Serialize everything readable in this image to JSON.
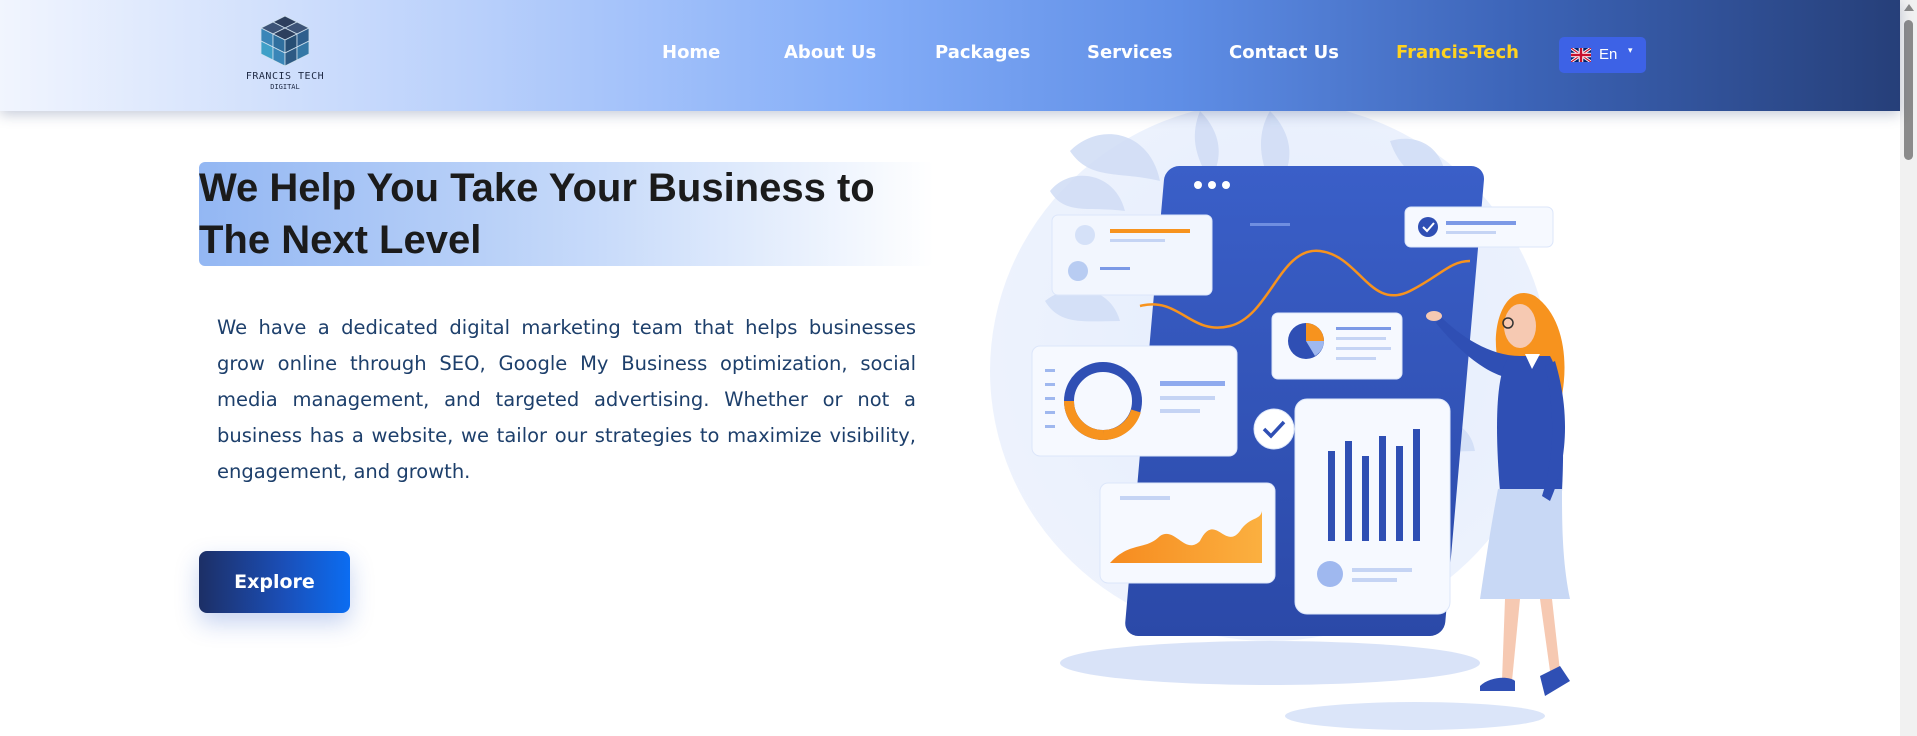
{
  "header": {
    "logo": {
      "name": "FRANCIS TECH",
      "sub": "DIGITAL"
    },
    "nav": [
      {
        "label": "Home"
      },
      {
        "label": "About Us"
      },
      {
        "label": "Packages"
      },
      {
        "label": "Services"
      },
      {
        "label": "Contact Us"
      },
      {
        "label": "Francis-Tech"
      }
    ],
    "language": {
      "label": "En",
      "flag": "uk-flag-icon"
    }
  },
  "hero": {
    "title_line1": "We Help You Take Your Business to",
    "title_line2": "The Next Level",
    "description": "We have a dedicated digital marketing team that helps businesses grow online through SEO, Google My Business optimization, social media management, and targeted advertising. Whether or not a business has a website, we tailor our strategies to maximize visibility, engagement, and growth.",
    "button_label": "Explore"
  },
  "colors": {
    "brand_accent": "#ffd21f",
    "nav_text": "#ffffff",
    "lang_button": "#3d62e6",
    "illustration_orange": "#f7931e",
    "illustration_blue": "#2f4fb4"
  },
  "icons": [
    "cube-logo-icon",
    "uk-flag-icon",
    "chevron-down-icon",
    "check-circle-icon",
    "donut-chart-icon",
    "pie-chart-icon",
    "bar-chart-icon",
    "area-chart-icon",
    "line-chart-icon"
  ]
}
